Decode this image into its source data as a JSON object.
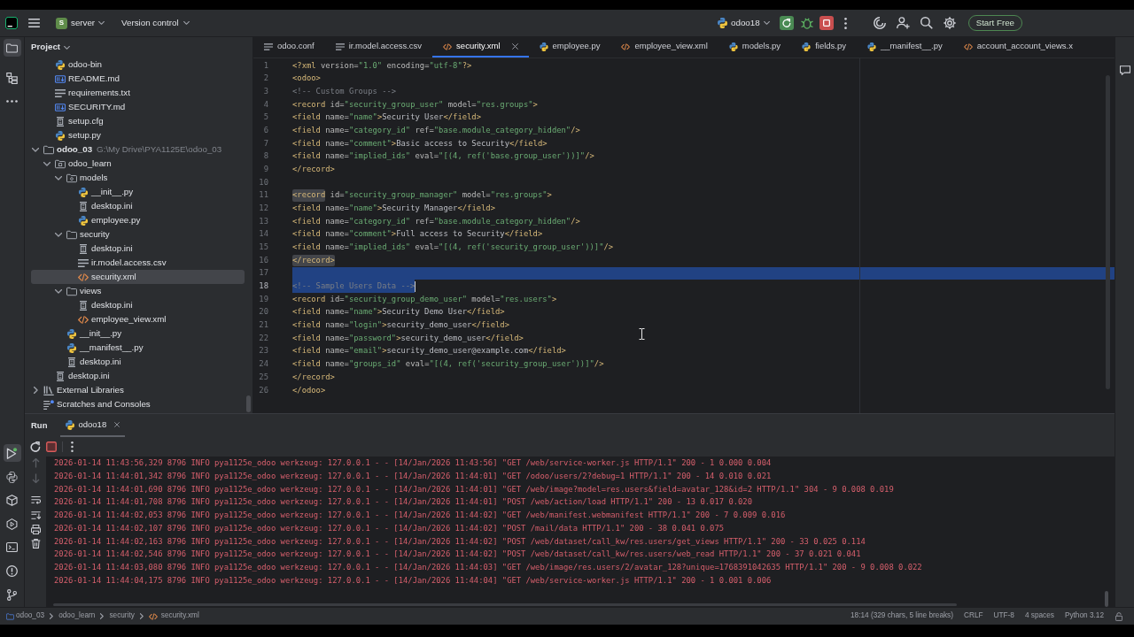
{
  "toolbar": {
    "project_badge": "S",
    "project": "server",
    "vcs": "Version control",
    "run_config": "odoo18",
    "trial_button": "Start Free"
  },
  "left_stripe": {
    "top": [
      {
        "kind": "project",
        "selected": true
      },
      {
        "kind": "structure",
        "selected": false
      },
      {
        "kind": "more",
        "selected": false
      }
    ],
    "bottom": [
      {
        "kind": "run",
        "selected": true
      },
      {
        "kind": "python_console",
        "selected": false
      },
      {
        "kind": "packages",
        "selected": false
      },
      {
        "kind": "services",
        "selected": false
      },
      {
        "kind": "terminal",
        "selected": false
      },
      {
        "kind": "problems",
        "selected": false
      },
      {
        "kind": "git",
        "selected": false
      }
    ]
  },
  "project_panel": {
    "title": "Project",
    "scrolled_items": [
      {
        "label": "odoo-bin",
        "kind": "python",
        "selected": false
      },
      {
        "label": "README.md",
        "kind": "markdown",
        "selected": false
      },
      {
        "label": "requirements.txt",
        "kind": "text",
        "selected": false
      },
      {
        "label": "SECURITY.md",
        "kind": "markdown",
        "selected": false
      },
      {
        "label": "setup.cfg",
        "kind": "config",
        "selected": false
      },
      {
        "label": "setup.py",
        "kind": "python",
        "selected": false
      }
    ],
    "items": [
      {
        "label": "odoo_03",
        "kind": "root",
        "path": "G:\\My Drive\\PYA1125E\\odoo_03",
        "expanded": true,
        "selected": false,
        "children": [
          {
            "label": "odoo_learn",
            "kind": "module",
            "expanded": true,
            "selected": false,
            "children": [
              {
                "label": "models",
                "kind": "package",
                "expanded": true,
                "selected": false,
                "children": [
                  {
                    "label": "__init__.py",
                    "kind": "python",
                    "selected": false
                  },
                  {
                    "label": "desktop.ini",
                    "kind": "config",
                    "selected": false
                  },
                  {
                    "label": "employee.py",
                    "kind": "python",
                    "selected": false
                  }
                ]
              },
              {
                "label": "security",
                "kind": "folder",
                "expanded": true,
                "selected": false,
                "children": [
                  {
                    "label": "desktop.ini",
                    "kind": "config",
                    "selected": false
                  },
                  {
                    "label": "ir.model.access.csv",
                    "kind": "text",
                    "selected": false
                  },
                  {
                    "label": "security.xml",
                    "kind": "xml",
                    "selected": true
                  }
                ]
              },
              {
                "label": "views",
                "kind": "folder",
                "expanded": true,
                "selected": false,
                "children": [
                  {
                    "label": "desktop.ini",
                    "kind": "config",
                    "selected": false
                  },
                  {
                    "label": "employee_view.xml",
                    "kind": "xml",
                    "selected": false
                  }
                ]
              },
              {
                "label": "__init__.py",
                "kind": "python",
                "selected": false
              },
              {
                "label": "__manifest__.py",
                "kind": "python",
                "selected": false
              },
              {
                "label": "desktop.ini",
                "kind": "config",
                "selected": false
              }
            ]
          },
          {
            "label": "desktop.ini",
            "kind": "config",
            "selected": false
          }
        ]
      },
      {
        "label": "External Libraries",
        "kind": "library",
        "expanded": false,
        "selected": false
      },
      {
        "label": "Scratches and Consoles",
        "kind": "scratches",
        "selected": false
      }
    ]
  },
  "editor": {
    "tabs": [
      {
        "label": "odoo.conf",
        "kind": "text",
        "selected": false
      },
      {
        "label": "ir.model.access.csv",
        "kind": "text",
        "selected": false
      },
      {
        "label": "security.xml",
        "kind": "xml",
        "selected": true
      },
      {
        "label": "employee.py",
        "kind": "python",
        "selected": false
      },
      {
        "label": "employee_view.xml",
        "kind": "xml",
        "selected": false
      },
      {
        "label": "models.py",
        "kind": "python",
        "selected": false
      },
      {
        "label": "fields.py",
        "kind": "python",
        "selected": false
      },
      {
        "label": "__manifest__.py",
        "kind": "python",
        "selected": false
      },
      {
        "label": "account_account_views.x",
        "kind": "xml",
        "selected": false
      }
    ],
    "lines": [
      {
        "number": "1",
        "text": "<?xml version=\"1.0\" encoding=\"utf-8\"?>",
        "selected": false,
        "current": false,
        "tag_highlight": false
      },
      {
        "number": "2",
        "text": "<odoo>",
        "selected": false,
        "current": false,
        "tag_highlight": false
      },
      {
        "number": "3",
        "text": "    <!-- Custom Groups -->",
        "selected": false,
        "current": false,
        "tag_highlight": false
      },
      {
        "number": "4",
        "text": "    <record id=\"security_group_user\" model=\"res.groups\">",
        "selected": false,
        "current": false,
        "tag_highlight": false
      },
      {
        "number": "5",
        "text": "        <field name=\"name\">Security User</field>",
        "selected": false,
        "current": false,
        "tag_highlight": false
      },
      {
        "number": "6",
        "text": "        <field name=\"category_id\" ref=\"base.module_category_hidden\"/>",
        "selected": false,
        "current": false,
        "tag_highlight": false
      },
      {
        "number": "7",
        "text": "        <field name=\"comment\">Basic access to Security</field>",
        "selected": false,
        "current": false,
        "tag_highlight": false
      },
      {
        "number": "8",
        "text": "        <field name=\"implied_ids\" eval=\"[(4, ref('base.group_user'))]\"/>",
        "selected": false,
        "current": false,
        "tag_highlight": false
      },
      {
        "number": "9",
        "text": "    </record>",
        "selected": false,
        "current": false,
        "tag_highlight": false
      },
      {
        "number": "10",
        "selected": false,
        "current": false
      },
      {
        "number": "11",
        "text": "    <record id=\"security_group_manager\" model=\"res.groups\">",
        "selected": false,
        "current": false,
        "tag_highlight": true
      },
      {
        "number": "12",
        "text": "        <field name=\"name\">Security Manager</field>",
        "selected": false,
        "current": false,
        "tag_highlight": false
      },
      {
        "number": "13",
        "text": "        <field name=\"category_id\" ref=\"base.module_category_hidden\"/>",
        "selected": false,
        "current": false,
        "tag_highlight": false
      },
      {
        "number": "14",
        "text": "        <field name=\"comment\">Full access to Security</field>",
        "selected": false,
        "current": false,
        "tag_highlight": false
      },
      {
        "number": "15",
        "text": "        <field name=\"implied_ids\" eval=\"[(4, ref('security_group_user'))]\"/>",
        "selected": false,
        "current": false,
        "tag_highlight": false
      },
      {
        "number": "16",
        "text": "    </record>",
        "selected": false,
        "current": false,
        "tag_highlight": true
      },
      {
        "number": "17",
        "selected": true,
        "current": false
      },
      {
        "number": "18",
        "text": "    <!-- Sample Users Data -->",
        "selected": true,
        "current": true,
        "tag_highlight": false
      },
      {
        "number": "19",
        "text": "    <record id=\"security_group_demo_user\" model=\"res.users\">",
        "selected": false,
        "current": false,
        "tag_highlight": false
      },
      {
        "number": "20",
        "text": "        <field name=\"name\">Security Demo User</field>",
        "selected": false,
        "current": false,
        "tag_highlight": false
      },
      {
        "number": "21",
        "text": "        <field name=\"login\">security_demo_user</field>",
        "selected": false,
        "current": false,
        "tag_highlight": false
      },
      {
        "number": "22",
        "text": "        <field name=\"password\">security_demo_user</field>",
        "selected": false,
        "current": false,
        "tag_highlight": false
      },
      {
        "number": "23",
        "text": "        <field name=\"email\">security_demo_user@example.com</field>",
        "selected": false,
        "current": false,
        "tag_highlight": false
      },
      {
        "number": "24",
        "text": "        <field name=\"groups_id\" eval=\"[(4, ref('security_group_user'))]\"/>",
        "selected": false,
        "current": false,
        "tag_highlight": false
      },
      {
        "number": "25",
        "text": "    </record>",
        "selected": false,
        "current": false,
        "tag_highlight": false
      },
      {
        "number": "26",
        "text": "</odoo>",
        "selected": false,
        "current": false,
        "tag_highlight": false
      }
    ]
  },
  "run_panel": {
    "title": "Run",
    "tabs": [
      {
        "label": "odoo18",
        "selected": true
      }
    ],
    "log_lines": [
      "2026-01-14 11:43:56,329 8796 INFO pya1125e_odoo werkzeug: 127.0.0.1 - - [14/Jan/2026 11:43:56] \"GET /web/service-worker.js HTTP/1.1\" 200 - 1 0.000 0.004",
      "2026-01-14 11:44:01,342 8796 INFO pya1125e_odoo werkzeug: 127.0.0.1 - - [14/Jan/2026 11:44:01] \"GET /odoo/users/2?debug=1 HTTP/1.1\" 200 - 14 0.010 0.021",
      "2026-01-14 11:44:01,690 8796 INFO pya1125e_odoo werkzeug: 127.0.0.1 - - [14/Jan/2026 11:44:01] \"GET /web/image?model=res.users&field=avatar_128&id=2 HTTP/1.1\" 304 - 9 0.008 0.019",
      "2026-01-14 11:44:01,708 8796 INFO pya1125e_odoo werkzeug: 127.0.0.1 - - [14/Jan/2026 11:44:01] \"POST /web/action/load HTTP/1.1\" 200 - 13 0.017 0.020",
      "2026-01-14 11:44:02,053 8796 INFO pya1125e_odoo werkzeug: 127.0.0.1 - - [14/Jan/2026 11:44:02] \"GET /web/manifest.webmanifest HTTP/1.1\" 200 - 7 0.009 0.016",
      "2026-01-14 11:44:02,107 8796 INFO pya1125e_odoo werkzeug: 127.0.0.1 - - [14/Jan/2026 11:44:02] \"POST /mail/data HTTP/1.1\" 200 - 38 0.041 0.075",
      "2026-01-14 11:44:02,163 8796 INFO pya1125e_odoo werkzeug: 127.0.0.1 - - [14/Jan/2026 11:44:02] \"POST /web/dataset/call_kw/res.users/get_views HTTP/1.1\" 200 - 33 0.025 0.114",
      "2026-01-14 11:44:02,546 8796 INFO pya1125e_odoo werkzeug: 127.0.0.1 - - [14/Jan/2026 11:44:02] \"POST /web/dataset/call_kw/res.users/web_read HTTP/1.1\" 200 - 37 0.021 0.041",
      "2026-01-14 11:44:03,080 8796 INFO pya1125e_odoo werkzeug: 127.0.0.1 - - [14/Jan/2026 11:44:03] \"GET /web/image/res.users/2/avatar_128?unique=1768391042635 HTTP/1.1\" 200 - 9 0.008 0.022",
      "2026-01-14 11:44:04,175 8796 INFO pya1125e_odoo werkzeug: 127.0.0.1 - - [14/Jan/2026 11:44:04] \"GET /web/service-worker.js HTTP/1.1\" 200 - 1 0.001 0.006"
    ]
  },
  "status_bar": {
    "breadcrumbs": [
      {
        "label": "odoo_03",
        "kind": "module"
      },
      {
        "label": "odoo_learn",
        "kind": "folder"
      },
      {
        "label": "security",
        "kind": "folder"
      },
      {
        "label": "security.xml",
        "kind": "xml"
      }
    ],
    "items": [
      "18:14 (329 chars, 5 line breaks)",
      "CRLF",
      "UTF-8",
      "4 spaces",
      "Python 3.12"
    ]
  }
}
